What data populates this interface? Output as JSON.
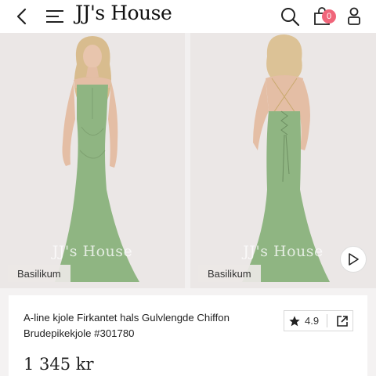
{
  "header": {
    "brand": "JJ's House",
    "cart_count": "0",
    "icons": [
      "back-chevron-icon",
      "menu-icon",
      "search-icon",
      "cart-icon",
      "account-icon"
    ]
  },
  "gallery": {
    "images": [
      {
        "watermark": "JJ's House",
        "color_label": "Basilikum"
      },
      {
        "watermark": "JJ's House",
        "color_label": "Basilikum"
      }
    ],
    "dress_color": "#8fb582",
    "play_icon": "play-icon"
  },
  "product": {
    "title": "A-line kjole Firkantet hals Gulvlengde Chiffon Brudepikekjole #301780",
    "rating": "4.9",
    "price": "1 345 kr",
    "icons": [
      "star-icon",
      "share-icon"
    ]
  }
}
